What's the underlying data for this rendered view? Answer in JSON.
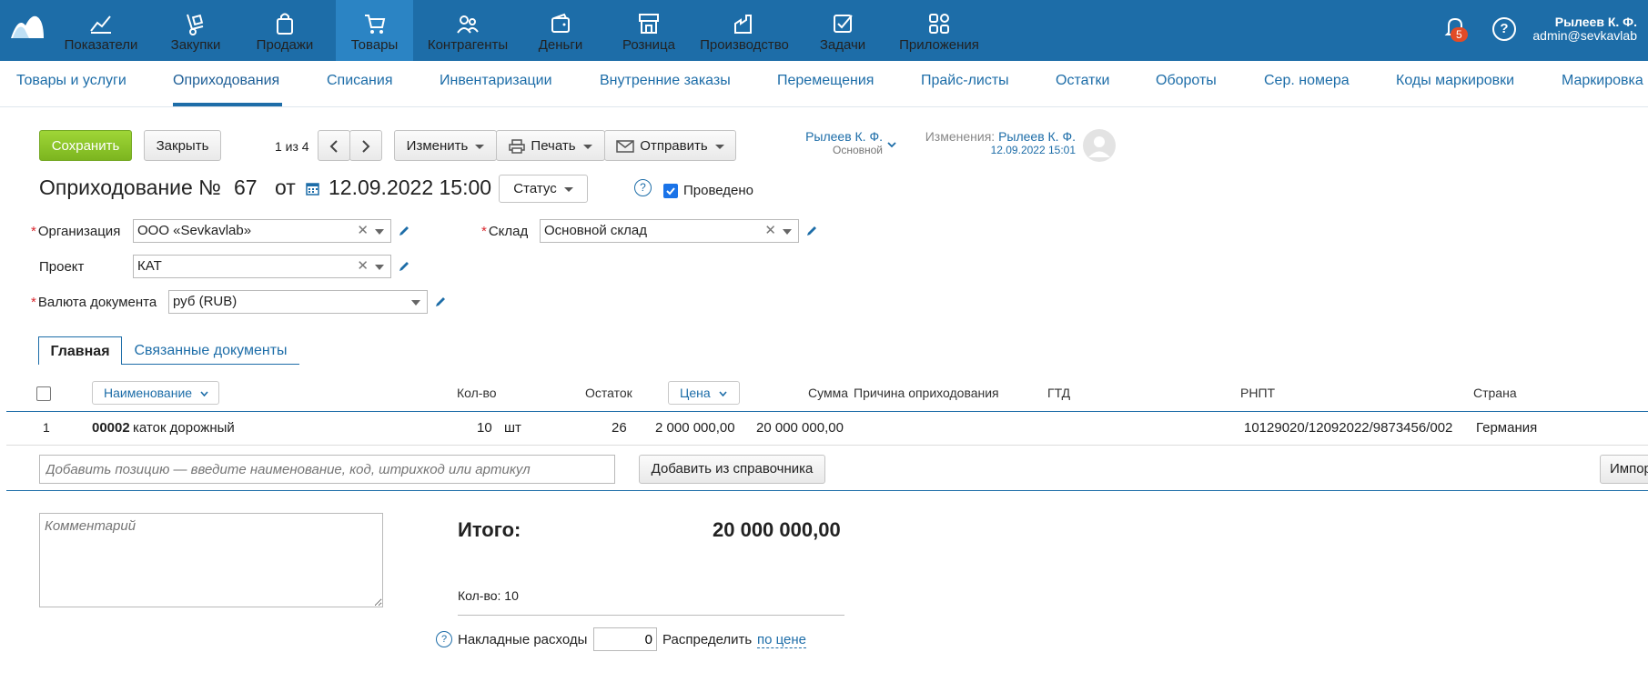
{
  "topnav": {
    "items": [
      {
        "label": "Показатели"
      },
      {
        "label": "Закупки"
      },
      {
        "label": "Продажи"
      },
      {
        "label": "Товары"
      },
      {
        "label": "Контрагенты"
      },
      {
        "label": "Деньги"
      },
      {
        "label": "Розница"
      },
      {
        "label": "Производство"
      },
      {
        "label": "Задачи"
      },
      {
        "label": "Приложения"
      }
    ],
    "active": "Товары",
    "notifications": "5",
    "help": "?",
    "user_name": "Рылеев К. Ф.",
    "user_email": "admin@sevkavlab"
  },
  "subnav": {
    "items": [
      {
        "label": "Товары и услуги"
      },
      {
        "label": "Оприходования"
      },
      {
        "label": "Списания"
      },
      {
        "label": "Инвентаризации"
      },
      {
        "label": "Внутренние заказы"
      },
      {
        "label": "Перемещения"
      },
      {
        "label": "Прайс-листы"
      },
      {
        "label": "Остатки"
      },
      {
        "label": "Обороты"
      },
      {
        "label": "Сер. номера"
      },
      {
        "label": "Коды маркировки"
      },
      {
        "label": "Маркировка"
      }
    ],
    "active": "Оприходования"
  },
  "toolbar": {
    "save": "Сохранить",
    "close": "Закрыть",
    "pager": "1 из 4",
    "edit": "Изменить",
    "print": "Печать",
    "send": "Отправить",
    "owner_name": "Рылеев К. Ф.",
    "owner_role": "Основной",
    "changes_label": "Изменения:",
    "changes_user": "Рылеев К. Ф.",
    "changes_date": "12.09.2022 15:01"
  },
  "document": {
    "title": "Оприходование №",
    "number": "67",
    "from": "от",
    "date": "12.09.2022 15:00",
    "status": "Статус",
    "posted_label": "Проведено",
    "posted": true
  },
  "form": {
    "org_label": "Организация",
    "org_value": "ООО «Sevkavlab»",
    "warehouse_label": "Склад",
    "warehouse_value": "Основной склад",
    "project_label": "Проект",
    "project_value": "КАТ",
    "currency_label": "Валюта документа",
    "currency_value": "руб (RUB)"
  },
  "tabs": {
    "main": "Главная",
    "related": "Связанные документы"
  },
  "table": {
    "headers": {
      "name": "Наименование",
      "qty": "Кол-во",
      "stock": "Остаток",
      "price": "Цена",
      "sum": "Сумма",
      "reason": "Причина оприходования",
      "gtd": "ГТД",
      "rnpt": "РНПТ",
      "country": "Страна"
    },
    "rows": [
      {
        "num": "1",
        "code": "00002",
        "name": "каток дорожный",
        "qty": "10",
        "unit": "шт",
        "stock": "26",
        "price": "2 000 000,00",
        "sum": "20 000 000,00",
        "rnpt": "10129020/12092022/9873456/002",
        "country": "Германия"
      }
    ],
    "add_placeholder": "Добавить позицию — введите наименование, код, штрихкод или артикул",
    "add_from_catalog": "Добавить из справочника",
    "import": "Импор"
  },
  "footer": {
    "comment_placeholder": "Комментарий",
    "total_label": "Итого:",
    "total_value": "20 000 000,00",
    "qty_summary": "Кол-во: 10",
    "overhead_label": "Накладные расходы",
    "overhead_value": "0",
    "distribute_label": "Распределить",
    "distribute_link": "по цене"
  },
  "colors": {
    "brand": "#1d6da8",
    "save_button": "#8cc63e",
    "badge": "#e24b26"
  }
}
